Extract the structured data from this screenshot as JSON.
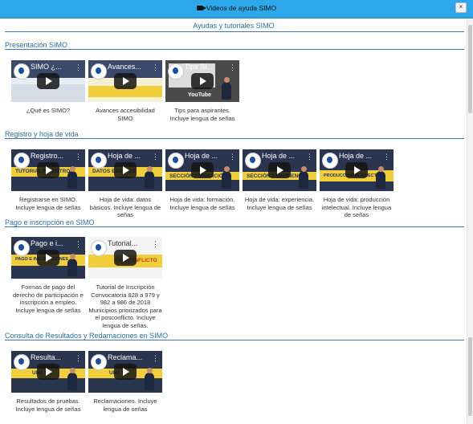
{
  "window": {
    "title": "Videos de ayuda SIMO",
    "close_label": "×",
    "camera_icon": "video-camera-icon"
  },
  "main_heading": "Ayudas y tutoriales SIMO",
  "sections": [
    {
      "title": "Presentación SIMO",
      "videos": [
        {
          "thumb_title": "SIMO ¿...",
          "caption": "¿Qué es SIMO?"
        },
        {
          "thumb_title": "Avances...",
          "caption": "Avances accesibilidad SIMO"
        },
        {
          "thumb_title": "Tips SI...",
          "overlay": "YouTube",
          "caption": "Tips para aspirantes. Incluye lengua de señas"
        }
      ]
    },
    {
      "title": "Registro y hoja de vida",
      "videos": [
        {
          "thumb_title": "Registro...",
          "overlay": "TUTORIAL REGISTRO",
          "caption": "Registrarse en SIMO. Incluye lengua de señas"
        },
        {
          "thumb_title": "Hoja de ...",
          "overlay": "DATOS BÁSICOS",
          "caption": "Hoja de vida: datos básicos. Incluye lengua de señas"
        },
        {
          "thumb_title": "Hoja de ...",
          "overlay": "SECCIÓN FORMACIÓN",
          "caption": "Hoja de vida: formación. Incluye lengua de señas"
        },
        {
          "thumb_title": "Hoja de ...",
          "overlay": "SECCIÓN EXPERIENCIA",
          "caption": "Hoja de vida: experiencia. Incluye lengua de señas"
        },
        {
          "thumb_title": "Hoja de ...",
          "overlay": "PRODUCCIÓN INTELECTUAL",
          "caption": "Hoja de vida: producción intelectual. Incluye lengua de señas"
        }
      ]
    },
    {
      "title": "Pago e inscripción en SIMO",
      "videos": [
        {
          "thumb_title": "Pago e i...",
          "overlay": "PAGO E INSCRIPCIONES",
          "caption": "Formas de pago del derecho de participación e inscripción a empleo. Incluye lengua de señas"
        },
        {
          "thumb_title": "Tutorial...",
          "overlay": "POSCONFLICTO",
          "caption": "Tutorial de Inscripción Convocatoria 828 a 979 y 982 a 986 de 2018 Municipios priorizados para el posconflicto. Incluye lengua de señas."
        }
      ]
    },
    {
      "title": "Consulta de Resultados y Redamaciones en SIMO",
      "videos": [
        {
          "thumb_title": "Resulta...",
          "overlay": "UNA P...",
          "caption": "Resultados de pruebas. Incluye lengua de señas"
        },
        {
          "thumb_title": "Reclama...",
          "overlay": "UNA P...",
          "caption": "Reclamaciones. Incluye lengua de señas"
        }
      ]
    }
  ],
  "colors": {
    "titlebar": "#2ca7ea",
    "accent": "#2e6ea6",
    "thumb_dark": "#2a3550",
    "thumb_yellow": "#f1cf3a"
  }
}
